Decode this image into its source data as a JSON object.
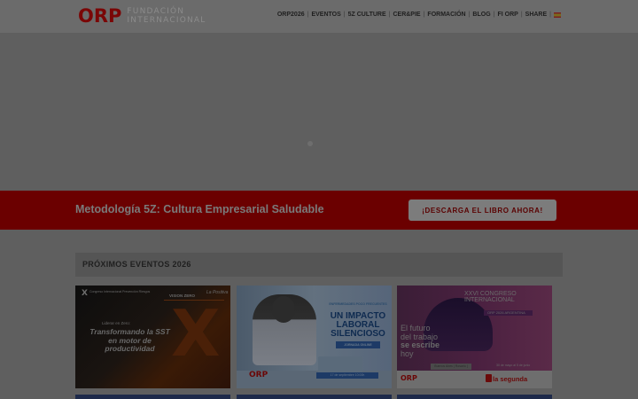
{
  "header": {
    "logo_mark": "ORP",
    "logo_line1": "FUNDACIÓN",
    "logo_line2": "INTERNACIONAL",
    "nav": [
      "ORP2026",
      "EVENTOS",
      "5Z CULTURE",
      "CER&PIE",
      "FORMACIÓN",
      "BLOG",
      "FI ORP",
      "SHARE"
    ],
    "separator": "|",
    "language_flag_icon": "spain-flag-icon"
  },
  "banner": {
    "title": "Metodología 5Z: Cultura Empresarial Saludable",
    "cta_label": "¡DESCARGA EL LIBRO AHORA!"
  },
  "events": {
    "section_title": "PRÓXIMOS EVENTOS 2026",
    "cards": [
      {
        "top_x": "X",
        "top_text": "Congreso Internacional Prevención Riesgos",
        "brand": "La Positiva",
        "vision": "VISION ZERO",
        "small": "Liderar en Zero:",
        "main": "Transformando la SST en motor de productividad"
      },
      {
        "kicker": "ENFERMEDADES POCO FRECUENTES",
        "title": "UN IMPACTO LABORAL SILENCIOSO",
        "tag": "JORNADA ONLINE",
        "logo": "ORP",
        "date": "17 de septiembre  10:00h"
      },
      {
        "headline_1": "XXVI CONGRESO",
        "headline_2": "INTERNACIONAL",
        "pill": "ORP 2026  ARGENTINA",
        "quote_1": "El futuro",
        "quote_2": "del trabajo",
        "quote_bold": "se escribe",
        "quote_4": "hoy",
        "place": "Buenos Aires | Rosario | Iguazú",
        "dates": "30 de mayo al 5 de junio",
        "orp": "ORP",
        "sponsor": "la segunda"
      }
    ]
  },
  "colors": {
    "overlay_bg": "#5f5f5f",
    "banner_red": "#6b0000",
    "brand_red": "#7a0606"
  }
}
